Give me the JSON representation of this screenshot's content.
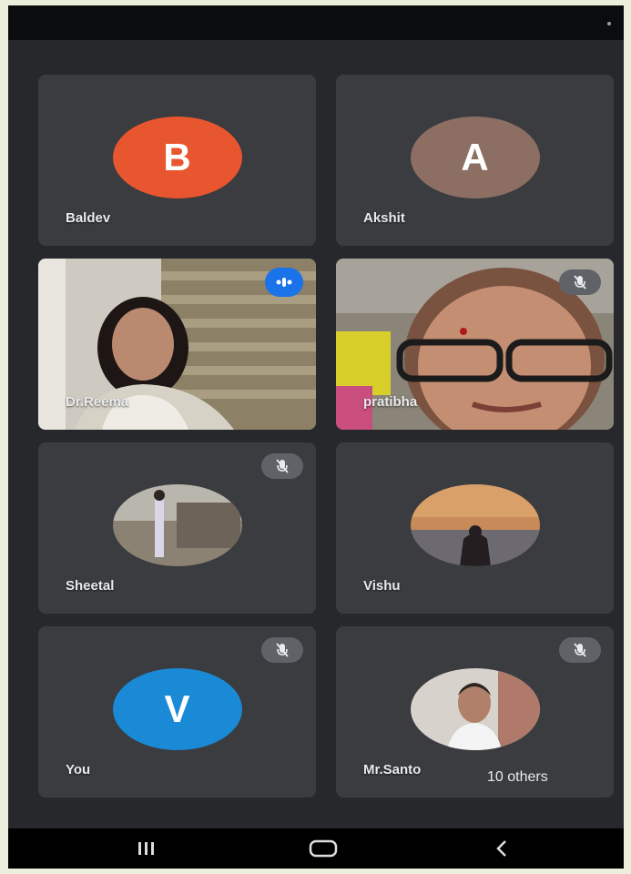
{
  "status_bar": {},
  "participants": [
    {
      "name": "Baldev",
      "initial": "B",
      "avatar_color": "#e8562f",
      "type": "initial"
    },
    {
      "name": "Akshit",
      "initial": "A",
      "avatar_color": "#8d6e63",
      "type": "initial"
    },
    {
      "name": "Dr.Reema",
      "type": "video",
      "speaking": true
    },
    {
      "name": "pratibha",
      "type": "video",
      "muted": true
    },
    {
      "name": "Sheetal",
      "type": "photo",
      "muted": true
    },
    {
      "name": "Vishu",
      "type": "photo"
    },
    {
      "name": "You",
      "initial": "V",
      "avatar_color": "#1a8ad6",
      "type": "initial",
      "muted": true
    },
    {
      "name": "Mr.Santo",
      "type": "photo",
      "muted": true
    }
  ],
  "others_pill": {
    "label": "10 others"
  },
  "nav": {
    "icons": [
      "recents-icon",
      "home-icon",
      "back-icon"
    ]
  },
  "colors": {
    "background": "#26282b",
    "tile": "#3a3c40",
    "speaking": "#1a73e8"
  }
}
